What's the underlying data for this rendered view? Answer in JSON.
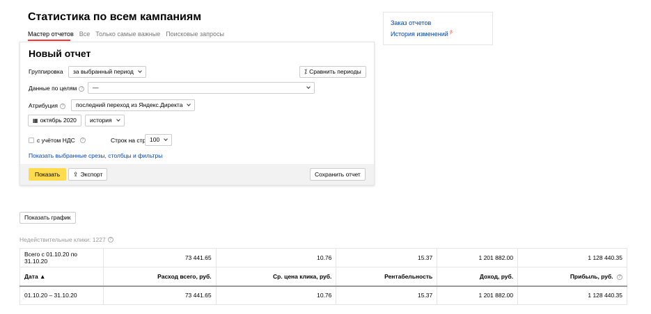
{
  "page": {
    "title": "Статистика по всем кампаниям",
    "tabs": [
      "Мастер отчетов",
      "Все",
      "Только самые важные",
      "Поисковые запросы"
    ]
  },
  "report": {
    "title": "Новый отчет",
    "grouping_label": "Группировка",
    "grouping_value": "за выбранный период",
    "compare_label": "Сравнить периоды",
    "goals_label": "Данные по целям",
    "goals_value": "—",
    "attribution_label": "Атрибуция",
    "attribution_value": "последний переход из Яндекс.Директа",
    "period_value": "октябрь 2020",
    "history_value": "история",
    "vat_label": "с учётом НДС",
    "rows_per_page_label": "Строк на странице",
    "rows_per_page_value": "100",
    "show_slices_link": "Показать выбранные срезы, столбцы и фильтры",
    "show_button": "Показать",
    "export_button": "Экспорт",
    "save_button": "Сохранить отчет"
  },
  "sidebar": {
    "order_reports": "Заказ отчетов",
    "history": "История изменений",
    "history_badge": "β"
  },
  "show_chart_button": "Показать график",
  "invalid_clicks": "Недействительные клики: 1227",
  "table": {
    "total_row": [
      "Всего с 01.10.20 по 31.10.20",
      "73 441.65",
      "10.76",
      "15.37",
      "1 201 882.00",
      "1 128 440.35"
    ],
    "headers": [
      "Дата ▲",
      "Расход всего, руб.",
      "Ср. цена клика, руб.",
      "Рентабельность",
      "Доход, руб.",
      "Прибыль, руб."
    ],
    "rows": [
      [
        "01.10.20 – 31.10.20",
        "73 441.65",
        "10.76",
        "15.37",
        "1 201 882.00",
        "1 128 440.35"
      ]
    ]
  },
  "colors": {
    "accent_tab": "#ff3333",
    "link": "#0044bb",
    "primary_button": "#ffdb4d"
  },
  "icons": [
    "help-icon",
    "chevron-down-icon",
    "compare-icon",
    "calendar-icon",
    "export-icon",
    "checkbox-icon"
  ]
}
